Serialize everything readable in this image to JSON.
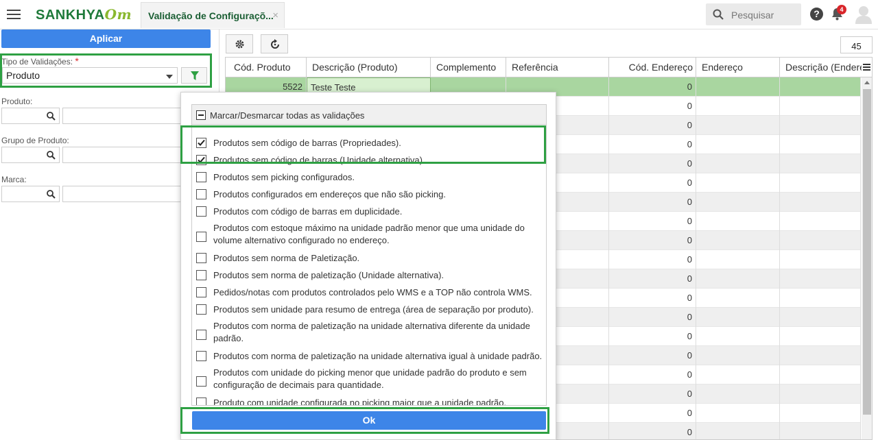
{
  "app": {
    "brand": "SANKHYA",
    "brand_suffix": "Om",
    "tab_title": "Validação de Configuraçõ...",
    "tab_close": "×",
    "search_placeholder": "Pesquisar",
    "help": "?",
    "notifications_count": "4"
  },
  "filters": {
    "apply_label": "Aplicar",
    "tipo_label": "Tipo de Validações:",
    "required_mark": "*",
    "tipo_value": "Produto",
    "produto_label": "Produto:",
    "grupo_label": "Grupo de Produto:",
    "marca_label": "Marca:"
  },
  "grid": {
    "record_count": "45",
    "columns": [
      "Cód. Produto",
      "Descrição (Produto)",
      "Complemento",
      "Referência",
      "Cód. Endereço",
      "Endereço",
      "Descrição (Endereço)"
    ],
    "selected_row": {
      "cod": "5522",
      "descricao": "Teste Teste",
      "cod_endereco": "0"
    },
    "other_rows_cod_endereco": [
      "0",
      "0",
      "0",
      "0",
      "0",
      "0",
      "0",
      "0",
      "0",
      "0",
      "0",
      "0",
      "0",
      "0",
      "0",
      "0",
      "0",
      "0"
    ]
  },
  "popup": {
    "select_all_label": "Marcar/Desmarcar todas as validações",
    "ok_label": "Ok",
    "items": [
      {
        "label": "Produtos sem código de barras (Propriedades).",
        "checked": true
      },
      {
        "label": "Produtos sem código de barras (Unidade alternativa).",
        "checked": true
      },
      {
        "label": "Produtos sem picking configurados.",
        "checked": false
      },
      {
        "label": "Produtos configurados em endereços que não são picking.",
        "checked": false
      },
      {
        "label": "Produtos com código de barras em duplicidade.",
        "checked": false
      },
      {
        "label": "Produtos com estoque máximo na unidade padrão menor que uma unidade do volume alternativo configurado no endereço.",
        "checked": false
      },
      {
        "label": "Produtos sem norma de Paletização.",
        "checked": false
      },
      {
        "label": "Produtos sem norma de paletização (Unidade alternativa).",
        "checked": false
      },
      {
        "label": "Pedidos/notas com produtos controlados pelo WMS e a TOP não controla WMS.",
        "checked": false
      },
      {
        "label": "Produtos sem unidade para resumo de entrega (área de separação por produto).",
        "checked": false
      },
      {
        "label": "Produtos com norma de paletização na unidade alternativa diferente da unidade padrão.",
        "checked": false
      },
      {
        "label": "Produtos com norma de paletização na unidade alternativa igual à unidade padrão.",
        "checked": false
      },
      {
        "label": "Produtos com unidade do picking menor que unidade padrão do produto e sem configuração de decimais para quantidade.",
        "checked": false
      },
      {
        "label": "Produto com unidade configurada no picking maior que a unidade padrão.",
        "checked": false
      }
    ]
  },
  "colors": {
    "accent_blue": "#3d85e8",
    "highlight_green": "#2ea043",
    "selected_row": "#a9d6a0"
  }
}
